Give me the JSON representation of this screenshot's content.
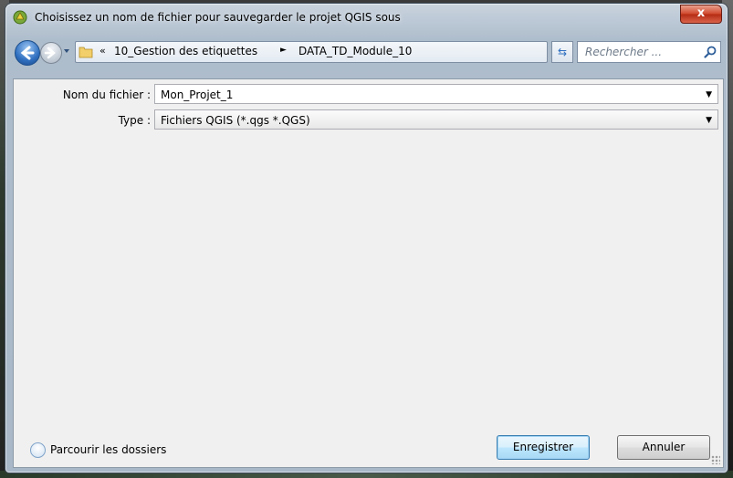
{
  "window": {
    "title": "Choisissez un nom de fichier pour sauvegarder le projet QGIS sous",
    "close_label": "x"
  },
  "addressbar": {
    "breadcrumb_prefix": "«",
    "crumbs": [
      "10_Gestion des etiquettes",
      "DATA_TD_Module_10"
    ],
    "separator": "►",
    "search_placeholder": "Rechercher ..."
  },
  "form": {
    "filename_label": "Nom du fichier :",
    "filename_value": "Mon_Projet_1",
    "type_label": "Type :",
    "type_value": "Fichiers QGIS (*.qgs *.QGS)"
  },
  "footer": {
    "browse_label": "Parcourir les dossiers",
    "save_label": "Enregistrer",
    "cancel_label": "Annuler"
  },
  "colors": {
    "close_button": "#d0472b",
    "primary_button_border": "#3c7fb1",
    "nav_back": "#2f6fc0"
  }
}
